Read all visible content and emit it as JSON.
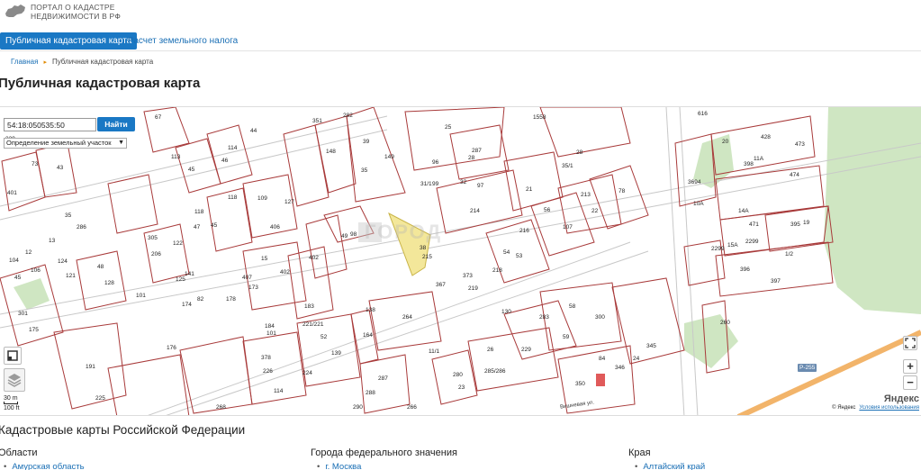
{
  "header": {
    "logo_line1": "ПОРТАЛ О КАДАСТРЕ",
    "logo_line2": "НЕДВИЖИМОСТИ В РФ"
  },
  "nav": {
    "tabs": [
      {
        "label": "Публичная кадастровая карта",
        "active": true
      },
      {
        "label": "Расчет земельного налога",
        "active": false
      }
    ]
  },
  "breadcrumb": {
    "home": "Главная",
    "current": "Публичная кадастровая карта"
  },
  "page": {
    "title": "Публичная кадастровая карта"
  },
  "map": {
    "search_value": "54:18:050535:50",
    "search_button": "Найти",
    "type_select": "Определение  земельный участок",
    "scale_small": "30 m",
    "scale_large": "100 ft",
    "yandex_logo": "Яндекс",
    "copyright": "© Яндекс",
    "terms_link": "Условия использования",
    "watermark": "ГОРОД",
    "highlight_color": "#f3e79a",
    "boundary_color": "#a83a3a",
    "road_badge": "Р-255",
    "street": "Вишневая ул.",
    "parcels": [
      "67",
      "351",
      "282",
      "1558",
      "616",
      "329",
      "73",
      "43",
      "401",
      "113",
      "45",
      "46",
      "114",
      "44",
      "39",
      "148",
      "35",
      "149",
      "25",
      "287",
      "96",
      "28",
      "97",
      "35/1",
      "28",
      "428",
      "473",
      "20",
      "398",
      "11А",
      "474",
      "3694",
      "10А",
      "14А",
      "471",
      "395",
      "19",
      "2299",
      "15А",
      "2299",
      "396",
      "1/2",
      "397",
      "73",
      "43",
      "31/1",
      "99",
      "32",
      "21",
      "213",
      "22",
      "78",
      "118",
      "109",
      "406",
      "127",
      "118",
      "47",
      "45",
      "49",
      "98",
      "214",
      "56",
      "107",
      "35",
      "286",
      "13",
      "12",
      "104",
      "106",
      "124",
      "121",
      "305",
      "206",
      "122",
      "48",
      "128",
      "141",
      "125",
      "101",
      "103",
      "45",
      "132",
      "301",
      "175",
      "174",
      "176",
      "82",
      "178",
      "407",
      "173",
      "15",
      "402",
      "402",
      "10",
      "38",
      "215",
      "216",
      "54",
      "53",
      "218",
      "373",
      "219",
      "367",
      "130",
      "184",
      "101",
      "183",
      "221/221",
      "138",
      "264",
      "283",
      "58",
      "300",
      "59",
      "345",
      "84",
      "346",
      "24",
      "350",
      "191",
      "225",
      "226",
      "378",
      "114",
      "224",
      "52",
      "139",
      "164",
      "287",
      "288",
      "280",
      "23",
      "285/286",
      "26",
      "229",
      "268",
      "290",
      "266",
      "11/1",
      "260"
    ]
  },
  "footer": {
    "section_title": "Кадастровые карты Российской Федерации",
    "columns": [
      {
        "title": "Области",
        "first_link": "Амурская область"
      },
      {
        "title": "Города федерального значения",
        "first_link": "г. Москва"
      },
      {
        "title": "Края",
        "first_link": "Алтайский край"
      }
    ]
  }
}
